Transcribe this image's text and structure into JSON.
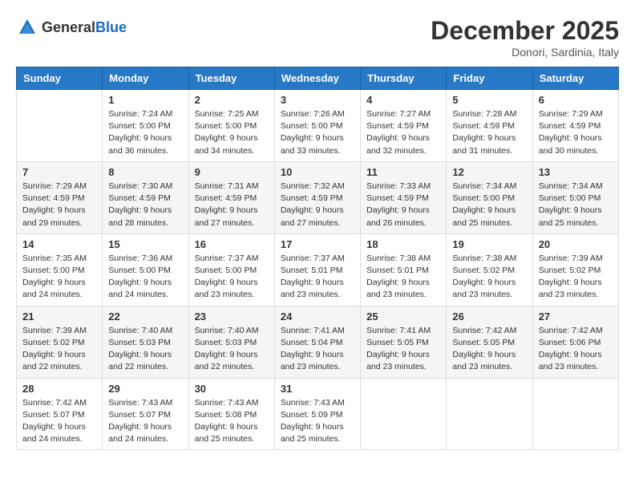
{
  "header": {
    "logo_general": "General",
    "logo_blue": "Blue",
    "month": "December 2025",
    "location": "Donori, Sardinia, Italy"
  },
  "weekdays": [
    "Sunday",
    "Monday",
    "Tuesday",
    "Wednesday",
    "Thursday",
    "Friday",
    "Saturday"
  ],
  "weeks": [
    [
      {
        "day": "",
        "info": ""
      },
      {
        "day": "1",
        "info": "Sunrise: 7:24 AM\nSunset: 5:00 PM\nDaylight: 9 hours\nand 36 minutes."
      },
      {
        "day": "2",
        "info": "Sunrise: 7:25 AM\nSunset: 5:00 PM\nDaylight: 9 hours\nand 34 minutes."
      },
      {
        "day": "3",
        "info": "Sunrise: 7:26 AM\nSunset: 5:00 PM\nDaylight: 9 hours\nand 33 minutes."
      },
      {
        "day": "4",
        "info": "Sunrise: 7:27 AM\nSunset: 4:59 PM\nDaylight: 9 hours\nand 32 minutes."
      },
      {
        "day": "5",
        "info": "Sunrise: 7:28 AM\nSunset: 4:59 PM\nDaylight: 9 hours\nand 31 minutes."
      },
      {
        "day": "6",
        "info": "Sunrise: 7:29 AM\nSunset: 4:59 PM\nDaylight: 9 hours\nand 30 minutes."
      }
    ],
    [
      {
        "day": "7",
        "info": "Sunrise: 7:29 AM\nSunset: 4:59 PM\nDaylight: 9 hours\nand 29 minutes."
      },
      {
        "day": "8",
        "info": "Sunrise: 7:30 AM\nSunset: 4:59 PM\nDaylight: 9 hours\nand 28 minutes."
      },
      {
        "day": "9",
        "info": "Sunrise: 7:31 AM\nSunset: 4:59 PM\nDaylight: 9 hours\nand 27 minutes."
      },
      {
        "day": "10",
        "info": "Sunrise: 7:32 AM\nSunset: 4:59 PM\nDaylight: 9 hours\nand 27 minutes."
      },
      {
        "day": "11",
        "info": "Sunrise: 7:33 AM\nSunset: 4:59 PM\nDaylight: 9 hours\nand 26 minutes."
      },
      {
        "day": "12",
        "info": "Sunrise: 7:34 AM\nSunset: 5:00 PM\nDaylight: 9 hours\nand 25 minutes."
      },
      {
        "day": "13",
        "info": "Sunrise: 7:34 AM\nSunset: 5:00 PM\nDaylight: 9 hours\nand 25 minutes."
      }
    ],
    [
      {
        "day": "14",
        "info": "Sunrise: 7:35 AM\nSunset: 5:00 PM\nDaylight: 9 hours\nand 24 minutes."
      },
      {
        "day": "15",
        "info": "Sunrise: 7:36 AM\nSunset: 5:00 PM\nDaylight: 9 hours\nand 24 minutes."
      },
      {
        "day": "16",
        "info": "Sunrise: 7:37 AM\nSunset: 5:00 PM\nDaylight: 9 hours\nand 23 minutes."
      },
      {
        "day": "17",
        "info": "Sunrise: 7:37 AM\nSunset: 5:01 PM\nDaylight: 9 hours\nand 23 minutes."
      },
      {
        "day": "18",
        "info": "Sunrise: 7:38 AM\nSunset: 5:01 PM\nDaylight: 9 hours\nand 23 minutes."
      },
      {
        "day": "19",
        "info": "Sunrise: 7:38 AM\nSunset: 5:02 PM\nDaylight: 9 hours\nand 23 minutes."
      },
      {
        "day": "20",
        "info": "Sunrise: 7:39 AM\nSunset: 5:02 PM\nDaylight: 9 hours\nand 23 minutes."
      }
    ],
    [
      {
        "day": "21",
        "info": "Sunrise: 7:39 AM\nSunset: 5:02 PM\nDaylight: 9 hours\nand 22 minutes."
      },
      {
        "day": "22",
        "info": "Sunrise: 7:40 AM\nSunset: 5:03 PM\nDaylight: 9 hours\nand 22 minutes."
      },
      {
        "day": "23",
        "info": "Sunrise: 7:40 AM\nSunset: 5:03 PM\nDaylight: 9 hours\nand 22 minutes."
      },
      {
        "day": "24",
        "info": "Sunrise: 7:41 AM\nSunset: 5:04 PM\nDaylight: 9 hours\nand 23 minutes."
      },
      {
        "day": "25",
        "info": "Sunrise: 7:41 AM\nSunset: 5:05 PM\nDaylight: 9 hours\nand 23 minutes."
      },
      {
        "day": "26",
        "info": "Sunrise: 7:42 AM\nSunset: 5:05 PM\nDaylight: 9 hours\nand 23 minutes."
      },
      {
        "day": "27",
        "info": "Sunrise: 7:42 AM\nSunset: 5:06 PM\nDaylight: 9 hours\nand 23 minutes."
      }
    ],
    [
      {
        "day": "28",
        "info": "Sunrise: 7:42 AM\nSunset: 5:07 PM\nDaylight: 9 hours\nand 24 minutes."
      },
      {
        "day": "29",
        "info": "Sunrise: 7:43 AM\nSunset: 5:07 PM\nDaylight: 9 hours\nand 24 minutes."
      },
      {
        "day": "30",
        "info": "Sunrise: 7:43 AM\nSunset: 5:08 PM\nDaylight: 9 hours\nand 25 minutes."
      },
      {
        "day": "31",
        "info": "Sunrise: 7:43 AM\nSunset: 5:09 PM\nDaylight: 9 hours\nand 25 minutes."
      },
      {
        "day": "",
        "info": ""
      },
      {
        "day": "",
        "info": ""
      },
      {
        "day": "",
        "info": ""
      }
    ]
  ]
}
